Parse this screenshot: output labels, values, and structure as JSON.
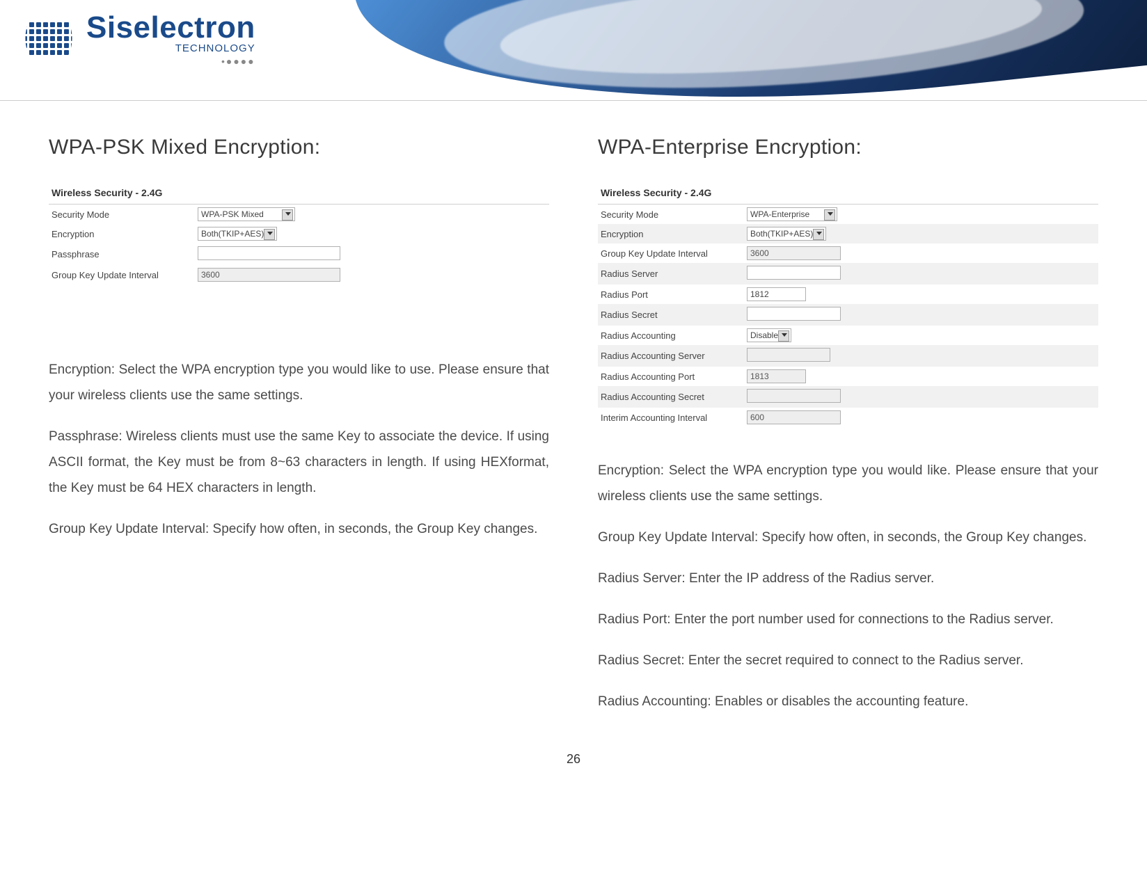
{
  "brand": {
    "name": "Siselectron",
    "sub": "TECHNOLOGY"
  },
  "page_number": "26",
  "left": {
    "title": "WPA-PSK Mixed Encryption:",
    "panel": {
      "title": "Wireless Security - 2.4G",
      "rows": {
        "security_mode": {
          "label": "Security Mode",
          "value": "WPA-PSK Mixed"
        },
        "encryption": {
          "label": "Encryption",
          "value": "Both(TKIP+AES)"
        },
        "passphrase": {
          "label": "Passphrase",
          "value": ""
        },
        "group_key": {
          "label": "Group Key Update Interval",
          "value": "3600"
        }
      }
    },
    "paras": {
      "p1": "Encryption: Select  the  WPA encryption type  you  would  like to  use. Please ensure that  your  wireless clients  use  the same  settings.",
      "p2": "Passphrase:  Wireless  clients  must  use  the  same  Key to associate the   device.   If  using   ASCII  format,   the   Key must  be  from  8~63 characters in  length.   If  using  HEXformat, the Key must  be  64  HEX characters in length.",
      "p3": "Group  Key Update Interval: Specify  how  often,  in seconds, the  Group Key changes."
    }
  },
  "right": {
    "title": "WPA-Enterprise Encryption:",
    "panel": {
      "title": "Wireless Security - 2.4G",
      "rows": {
        "security_mode": {
          "label": "Security Mode",
          "value": "WPA-Enterprise"
        },
        "encryption": {
          "label": "Encryption",
          "value": "Both(TKIP+AES)"
        },
        "group_key": {
          "label": "Group Key Update Interval",
          "value": "3600"
        },
        "radius_server": {
          "label": "Radius Server",
          "value": ""
        },
        "radius_port": {
          "label": "Radius Port",
          "value": "1812"
        },
        "radius_secret": {
          "label": "Radius Secret",
          "value": ""
        },
        "radius_accounting": {
          "label": "Radius Accounting",
          "value": "Disable"
        },
        "ra_server": {
          "label": "Radius Accounting Server",
          "value": ""
        },
        "ra_port": {
          "label": "Radius Accounting Port",
          "value": "1813"
        },
        "ra_secret": {
          "label": "Radius Accounting Secret",
          "value": ""
        },
        "interim": {
          "label": "Interim Accounting Interval",
          "value": "600"
        }
      }
    },
    "paras": {
      "p1": "Encryption: Select  the  WPA encryption type  you  would  like. Please ensure that your wireless clients  use  the  same  settings.",
      "p2": "Group  Key Update Interval: Specify  how  often,  in seconds, the  Group Key changes.",
      "p3": "Radius  Server:  Enter  the  IP address of the  Radius  server.",
      "p4": "Radius   Port:   Enter   the   port   number   used   for  connections to  the Radius  server.",
      "p5": "Radius Secret:  Enter  the  secret required  to  connect to  the Radius  server.",
      "p6": "Radius   Accounting:  Enables   or  disables   the    accounting feature."
    }
  }
}
